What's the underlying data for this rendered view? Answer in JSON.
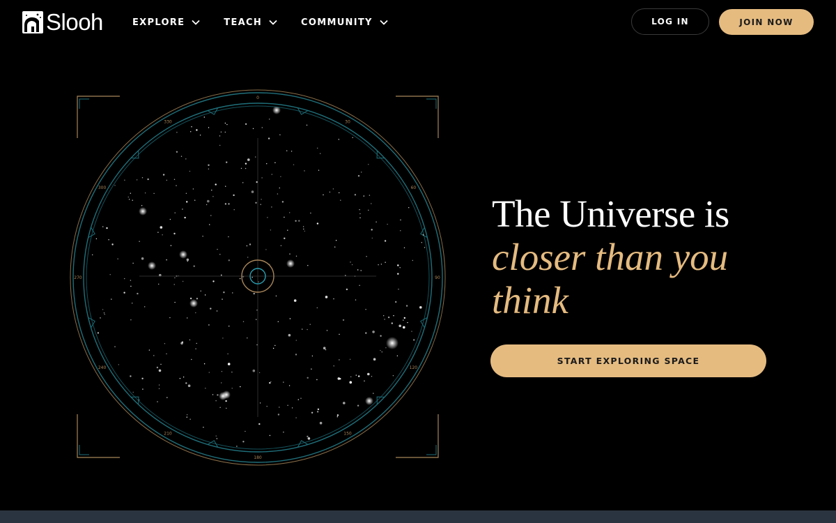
{
  "brand": {
    "name": "Slooh",
    "logo_icon": "telescope-dome-logo-icon"
  },
  "nav": {
    "items": [
      {
        "label": "EXPLORE",
        "icon": "chevron-down-icon"
      },
      {
        "label": "TEACH",
        "icon": "chevron-down-icon"
      },
      {
        "label": "COMMUNITY",
        "icon": "chevron-down-icon"
      }
    ]
  },
  "auth": {
    "login_label": "LOG IN",
    "join_label": "JOIN NOW"
  },
  "hero": {
    "title_line1": "The Universe is",
    "title_accent_line2": "closer than you",
    "title_accent_line3": "think",
    "cta_label": "START EXPLORING SPACE"
  },
  "star_chart": {
    "degree_labels": [
      "0",
      "30",
      "60",
      "90",
      "120",
      "150",
      "180",
      "210",
      "240",
      "270",
      "300",
      "330"
    ]
  },
  "colors": {
    "background": "#000000",
    "accent": "#e5bb80",
    "ring_teal": "#1f6f7a",
    "ring_gold": "#a8865a",
    "footer_strip": "#2a3440"
  }
}
